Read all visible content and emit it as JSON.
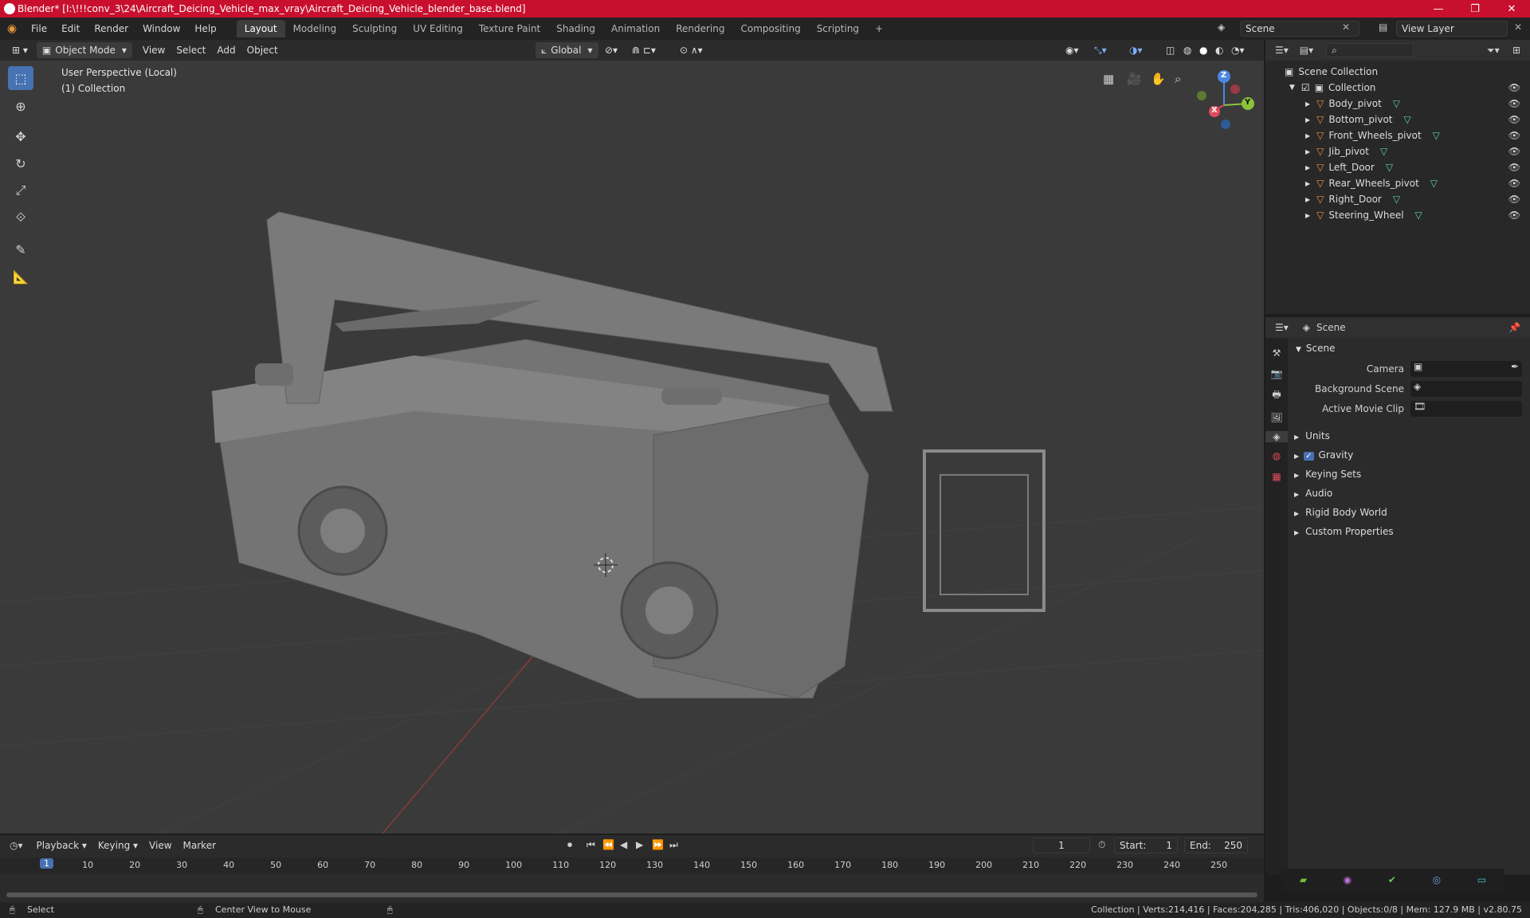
{
  "window": {
    "title": "Blender* [I:\\!!!conv_3\\24\\Aircraft_Deicing_Vehicle_max_vray\\Aircraft_Deicing_Vehicle_blender_base.blend]",
    "minimize": "—",
    "maximize": "❐",
    "close": "✕"
  },
  "menu": [
    "File",
    "Edit",
    "Render",
    "Window",
    "Help"
  ],
  "workspaces": [
    "Layout",
    "Modeling",
    "Sculpting",
    "UV Editing",
    "Texture Paint",
    "Shading",
    "Animation",
    "Rendering",
    "Compositing",
    "Scripting"
  ],
  "workspace_add": "+",
  "scene_name": "Scene",
  "view_layer": "View Layer",
  "viewport": {
    "mode": "Object Mode",
    "menus": [
      "View",
      "Select",
      "Add",
      "Object"
    ],
    "orientation": "Global",
    "overlay_line1": "User Perspective (Local)",
    "overlay_line2": "(1) Collection",
    "gizmo": {
      "z": "Z",
      "y": "Y",
      "x": "X"
    }
  },
  "outliner": {
    "root": "Scene Collection",
    "collection": "Collection",
    "items": [
      "Body_pivot",
      "Bottom_pivot",
      "Front_Wheels_pivot",
      "Jib_pivot",
      "Left_Door",
      "Rear_Wheels_pivot",
      "Right_Door",
      "Steering_Wheel"
    ]
  },
  "properties": {
    "header": "Scene",
    "section": "Scene",
    "fields": [
      {
        "label": "Camera"
      },
      {
        "label": "Background Scene"
      },
      {
        "label": "Active Movie Clip"
      }
    ],
    "subsections": [
      "Units",
      "Gravity",
      "Keying Sets",
      "Audio",
      "Rigid Body World",
      "Custom Properties"
    ]
  },
  "timeline": {
    "menus": [
      "Playback",
      "Keying",
      "View",
      "Marker"
    ],
    "current_frame": "1",
    "start_label": "Start:",
    "start": "1",
    "end_label": "End:",
    "end": "250",
    "ticks": [
      "1",
      "10",
      "20",
      "30",
      "40",
      "50",
      "60",
      "70",
      "80",
      "90",
      "100",
      "110",
      "120",
      "130",
      "140",
      "150",
      "160",
      "170",
      "180",
      "190",
      "200",
      "210",
      "220",
      "230",
      "240",
      "250"
    ]
  },
  "status": {
    "left": "Select",
    "middle": "Center View to Mouse",
    "right": "Collection | Verts:214,416 | Faces:204,285 | Tris:406,020 | Objects:0/8 | Mem: 127.9 MB | v2.80.75"
  },
  "colors": {
    "accent": "#4772b3",
    "titlebar": "#c8102e",
    "object_icon": "#e8953a",
    "mesh_icon": "#5fd3a0"
  }
}
